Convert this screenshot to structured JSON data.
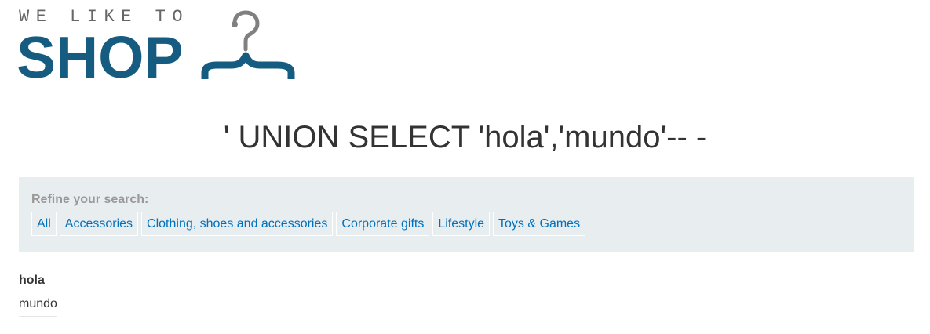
{
  "logo": {
    "tagline": "WE LIKE TO",
    "brand": "SHOP",
    "icon": "hanger-icon",
    "brand_color": "#155c80"
  },
  "page_title": "' UNION SELECT 'hola','mundo'-- -",
  "filter": {
    "label": "Refine your search:",
    "categories": [
      "All",
      "Accessories",
      "Clothing, shoes and accessories",
      "Corporate gifts",
      "Lifestyle",
      "Toys & Games"
    ],
    "link_color": "#0071bc",
    "panel_color": "#e8edf0"
  },
  "results": [
    {
      "title": "hola",
      "body": "mundo"
    }
  ]
}
